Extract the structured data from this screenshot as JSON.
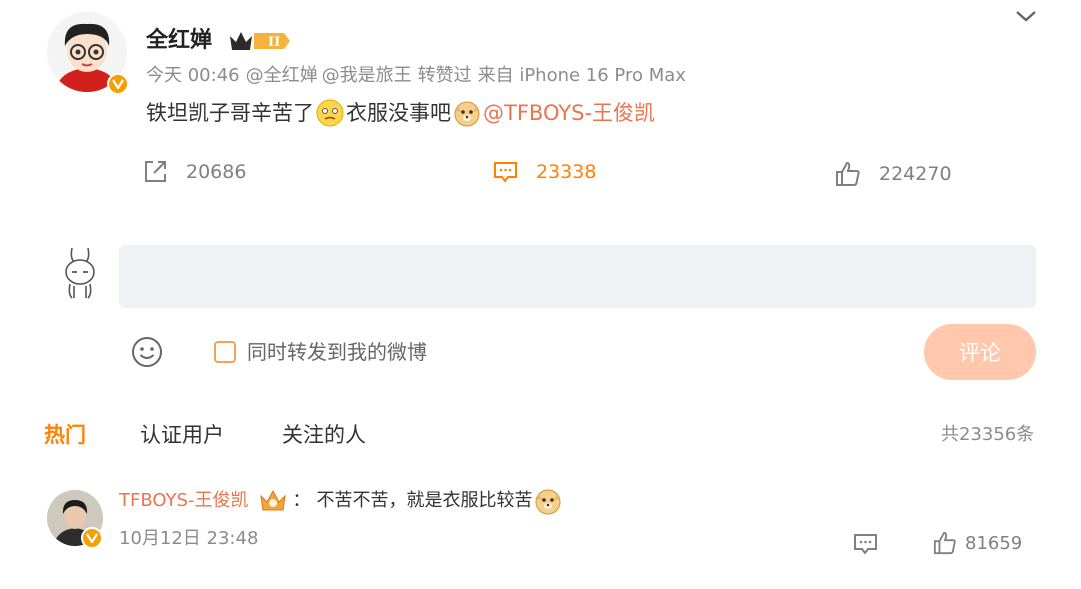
{
  "post": {
    "author": "全红婵",
    "level_badge_text": "II",
    "meta": {
      "time": "今天 00:46",
      "mention1": "@全红婵",
      "mention2": "@我是旅王",
      "liked_by": "转赞过",
      "source": "来自 iPhone 16 Pro Max"
    },
    "text_part1": "铁坦凯子哥辛苦了",
    "text_part2": "衣服没事吧",
    "mention": "@TFBOYS-王俊凯",
    "actions": {
      "repost_count": "20686",
      "comment_count": "23338",
      "like_count": "224270"
    }
  },
  "composer": {
    "placeholder": "",
    "repost_label": "同时转发到我的微博",
    "submit_label": "评论"
  },
  "tabs": {
    "hot": "热门",
    "verified": "认证用户",
    "following": "关注的人",
    "total": "共23356条"
  },
  "comments": [
    {
      "name": "TFBOYS-王俊凯",
      "separator": "：",
      "text": "不苦不苦，就是衣服比较苦",
      "time": "10月12日 23:48",
      "like_count": "81659"
    }
  ],
  "colors": {
    "accent": "#ff8200",
    "link": "#eb7350",
    "muted": "#8c8c8c",
    "verified": "#f6a000",
    "button": "#ffc7ab"
  },
  "icons": {
    "repost": "repost-icon",
    "comment": "comment-icon",
    "like": "like-icon",
    "emoji": "smiley-icon",
    "expand": "chevron-down-icon"
  }
}
